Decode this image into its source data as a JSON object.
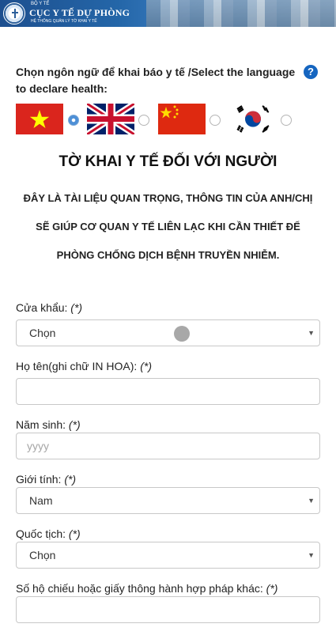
{
  "header": {
    "ministry": "BỘ Y TẾ",
    "title": "CỤC Y TẾ DỰ PHÒNG",
    "subtitle": "HỆ THỐNG QUẢN LÝ TỜ KHAI Y TẾ"
  },
  "language": {
    "prompt": "Chọn ngôn ngữ để khai báo y tế /Select the language to declare health:",
    "help_icon": "question-circle-icon",
    "options": [
      {
        "flag": "vietnam-flag-icon",
        "selected": true
      },
      {
        "flag": "uk-flag-icon",
        "selected": false
      },
      {
        "flag": "china-flag-icon",
        "selected": false
      },
      {
        "flag": "korea-flag-icon",
        "selected": false
      }
    ]
  },
  "form": {
    "title": "TỜ KHAI Y TẾ ĐỐI VỚI NGƯỜI",
    "notice_line1": "ĐÂY LÀ TÀI LIỆU QUAN TRỌNG, THÔNG TIN CỦA ANH/CHỊ",
    "notice_line2": "SẼ GIÚP CƠ QUAN Y TẾ LIÊN LẠC KHI CẦN THIẾT ĐỂ",
    "notice_line3": "PHÒNG CHỐNG DỊCH BỆNH TRUYỀN NHIỄM.",
    "required_mark": "(*)",
    "fields": {
      "border_gate": {
        "label": "Cửa khẩu:",
        "value": "Chọn"
      },
      "full_name": {
        "label": "Họ tên(ghi chữ IN HOA):",
        "value": ""
      },
      "birth_year": {
        "label": "Năm sinh:",
        "placeholder": "yyyy"
      },
      "gender": {
        "label": "Giới tính:",
        "value": "Nam"
      },
      "nationality": {
        "label": "Quốc tịch:",
        "value": "Chọn"
      },
      "passport": {
        "label": "Số hộ chiếu hoặc giấy thông hành hợp pháp khác:",
        "value": ""
      }
    }
  },
  "colors": {
    "accent": "#1565c0",
    "radio_selected": "#4d8fd6",
    "input_border": "#c8c8c8"
  }
}
